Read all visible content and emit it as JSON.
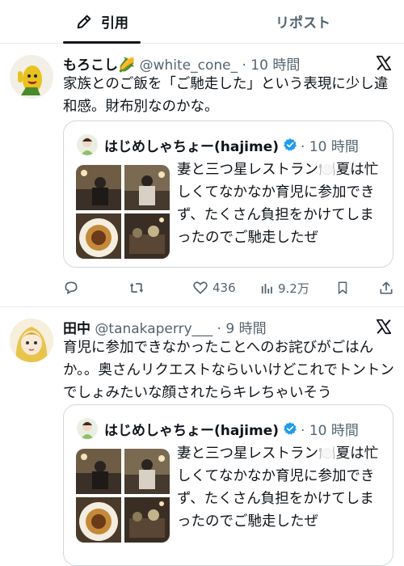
{
  "tabs": {
    "quote": "引用",
    "repost": "リポスト"
  },
  "tweets": [
    {
      "name": "もろこし🌽",
      "handle": "@white_cone_",
      "time": "· 10 時間",
      "text": "家族とのご飯を「ご馳走した」という表現に少し違和感。財布別なのかな。",
      "quote": {
        "name": "はじめしゃちょー(hajime)",
        "time": "· 10 時間",
        "text": "妻と三つ星レストラン🍽️夏は忙しくてなかなか育児に参加できず、たくさん負担をかけてしまったのでご馳走したぜ"
      },
      "metrics": {
        "likes": "436",
        "views": "9.2万"
      }
    },
    {
      "name": "田中",
      "handle": "@tanakaperry___",
      "time": "· 9 時間",
      "text": "育児に参加できなかったことへのお詫びがごはんか。。奥さんリクエストならいいけどこれでトントンでしょみたいな顔されたらキレちゃいそう",
      "quote": {
        "name": "はじめしゃちょー(hajime)",
        "time": "· 10 時間",
        "text": "妻と三つ星レストラン🍽️夏は忙しくてなかなか育児に参加できず、たくさん負担をかけてしまったのでご馳走したぜ"
      }
    }
  ],
  "icons": {
    "quote_tab": "pencil-icon",
    "x_logo": "x-logo-icon",
    "verified": "verified-badge-icon",
    "reply": "reply-icon",
    "retweet": "retweet-icon",
    "like": "heart-icon",
    "views": "views-icon",
    "bookmark": "bookmark-icon",
    "share": "share-icon"
  },
  "colors": {
    "verified": "#1d9bf0",
    "text": "#0f1419",
    "secondary": "#536471",
    "border": "#cfd9de"
  }
}
